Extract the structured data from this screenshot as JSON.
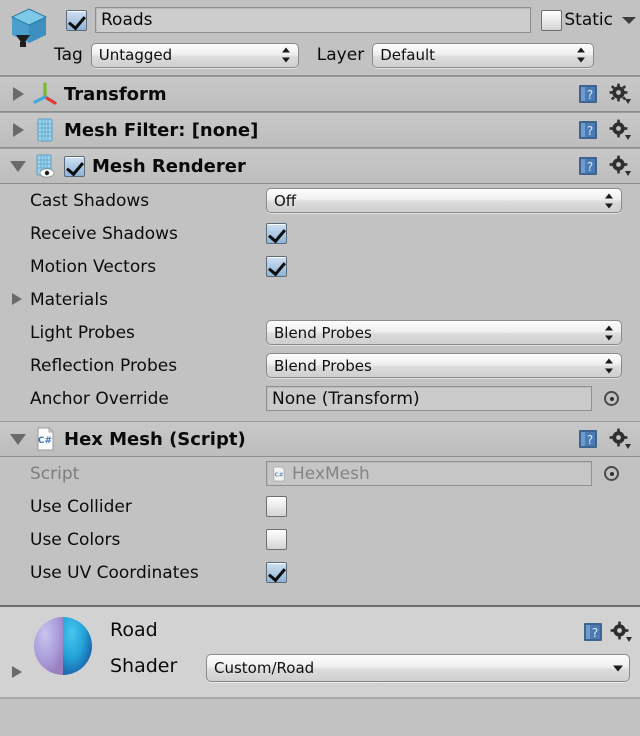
{
  "header": {
    "icon": "gameobject-cube-icon",
    "active_checkbox": true,
    "name_value": "Roads",
    "static_label": "Static",
    "static_checked": false,
    "tag_label": "Tag",
    "tag_value": "Untagged",
    "layer_label": "Layer",
    "layer_value": "Default"
  },
  "components": [
    {
      "id": "transform",
      "title": "Transform",
      "icon": "transform-axis-icon",
      "expanded": false,
      "has_enable_checkbox": false
    },
    {
      "id": "mesh-filter",
      "title": "Mesh Filter: [none]",
      "icon": "mesh-filter-icon",
      "expanded": false,
      "has_enable_checkbox": false
    },
    {
      "id": "mesh-renderer",
      "title": "Mesh Renderer",
      "icon": "mesh-renderer-icon",
      "expanded": true,
      "has_enable_checkbox": true,
      "enabled": true
    },
    {
      "id": "hex-mesh-script",
      "title": "Hex Mesh (Script)",
      "icon": "csharp-script-icon",
      "expanded": true,
      "has_enable_checkbox": false
    }
  ],
  "mesh_renderer": {
    "cast_shadows": {
      "label": "Cast Shadows",
      "value": "Off"
    },
    "receive_shadows": {
      "label": "Receive Shadows",
      "checked": true
    },
    "motion_vectors": {
      "label": "Motion Vectors",
      "checked": true
    },
    "materials": {
      "label": "Materials",
      "expanded": false
    },
    "light_probes": {
      "label": "Light Probes",
      "value": "Blend Probes"
    },
    "reflection_probes": {
      "label": "Reflection Probes",
      "value": "Blend Probes"
    },
    "anchor_override": {
      "label": "Anchor Override",
      "value": "None (Transform)"
    }
  },
  "hex_mesh": {
    "script": {
      "label": "Script",
      "value": "HexMesh"
    },
    "use_collider": {
      "label": "Use Collider",
      "checked": false
    },
    "use_colors": {
      "label": "Use Colors",
      "checked": false
    },
    "use_uv_coordinates": {
      "label": "Use UV Coordinates",
      "checked": true
    }
  },
  "material": {
    "name": "Road",
    "shader_label": "Shader",
    "shader_value": "Custom/Road",
    "preview_icon": "material-sphere-preview"
  },
  "icons": {
    "help": "help-book-icon",
    "gear": "gear-icon",
    "picker": "object-picker-icon",
    "static_dropdown": "chevron-down-icon"
  },
  "colors": {
    "window_bg": "#c2c2c2",
    "header_bar": "#c8c8c8",
    "material_block_bg": "#d2d2d2",
    "checkbox_on": "#8fb4d8",
    "accent_blue": "#3c74b4"
  }
}
